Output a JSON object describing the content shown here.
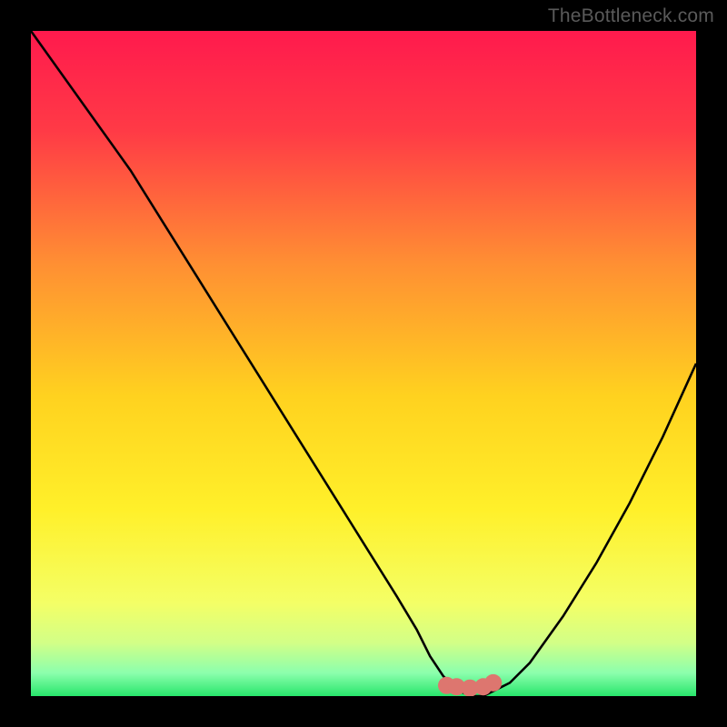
{
  "watermark": "TheBottleneck.com",
  "accent": {
    "curve_color": "#000000",
    "marker_color": "#dd766f"
  },
  "gradient_stops": [
    {
      "pct": 0,
      "color": "#ff1a4d"
    },
    {
      "pct": 15,
      "color": "#ff3a46"
    },
    {
      "pct": 35,
      "color": "#ff8f33"
    },
    {
      "pct": 55,
      "color": "#ffd21f"
    },
    {
      "pct": 72,
      "color": "#fff02a"
    },
    {
      "pct": 86,
      "color": "#f4ff66"
    },
    {
      "pct": 92,
      "color": "#d2ff87"
    },
    {
      "pct": 96.5,
      "color": "#8cffad"
    },
    {
      "pct": 100,
      "color": "#28e66b"
    }
  ],
  "chart_data": {
    "type": "line",
    "title": "",
    "xlabel": "",
    "ylabel": "",
    "xlim": [
      0,
      100
    ],
    "ylim": [
      0,
      100
    ],
    "series": [
      {
        "name": "bottleneck-curve",
        "x": [
          0,
          5,
          10,
          15,
          20,
          25,
          30,
          35,
          40,
          45,
          50,
          55,
          58,
          60,
          62,
          64,
          66,
          68,
          70,
          72,
          75,
          80,
          85,
          90,
          95,
          100
        ],
        "y": [
          100,
          93,
          86,
          79,
          71,
          63,
          55,
          47,
          39,
          31,
          23,
          15,
          10,
          6,
          3,
          1,
          0,
          0,
          1,
          2,
          5,
          12,
          20,
          29,
          39,
          50
        ]
      }
    ],
    "markers": {
      "name": "optimum-range",
      "x": [
        62.5,
        64,
        66,
        68,
        69.5
      ],
      "y": [
        1.6,
        1.4,
        1.2,
        1.4,
        2.0
      ]
    }
  }
}
